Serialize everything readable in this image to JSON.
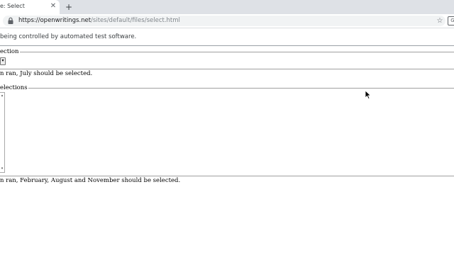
{
  "browser": {
    "tab_title": "e: Select",
    "tab_close": "✕",
    "new_tab": "+",
    "url_scheme_host": "https://openwritings.net",
    "url_path": "/sites/default/files/select.html",
    "star_icon": "☆",
    "extension_icon": "G"
  },
  "infobar": {
    "text": "being controlled by automated test software."
  },
  "page": {
    "single_selection": {
      "legend": "ection",
      "dropdown_arrow": "▾",
      "note": "n ran, July should be selected."
    },
    "multiple_selections": {
      "legend": "elections",
      "scroll_up": "▴",
      "scroll_down": "▾",
      "note": "n ran, February, August and November should be selected."
    }
  }
}
